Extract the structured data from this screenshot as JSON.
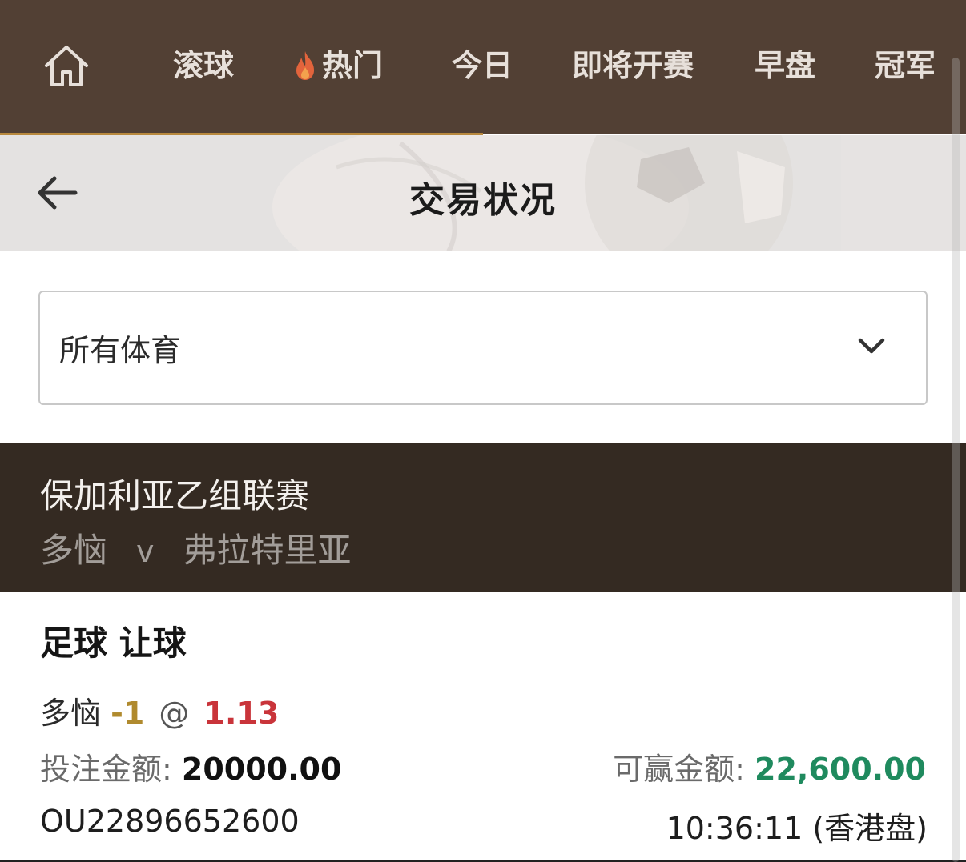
{
  "nav": {
    "home_icon": "home-icon",
    "items": [
      {
        "label": "滚球"
      },
      {
        "label": "热门",
        "icon": "fire-icon"
      },
      {
        "label": "今日"
      },
      {
        "label": "即将开赛"
      },
      {
        "label": "早盘"
      },
      {
        "label": "冠军"
      }
    ],
    "accent": "#b8893e"
  },
  "header": {
    "back_icon": "arrow-left-icon",
    "title": "交易状况"
  },
  "filter": {
    "selected": "所有体育",
    "icon": "chevron-down-icon"
  },
  "league": {
    "name": "保加利亚乙组联赛",
    "home": "多恼",
    "vs": "v",
    "away": "弗拉特里亚"
  },
  "bet": {
    "type": "足球 让球",
    "selection": "多恼",
    "handicap": "-1",
    "at": "@",
    "odds": "1.13",
    "stake_label": "投注金额:",
    "stake_value": "20000.00",
    "win_label": "可赢金额:",
    "win_value": "22,600.00",
    "ticket_id": "OU22896652600",
    "time": "10:36:11",
    "odds_format": "(香港盘)"
  },
  "colors": {
    "nav_bg": "#524034",
    "league_bg": "#342a22",
    "odds": "#c9343a",
    "handicap": "#b08a2e",
    "win": "#1f8a5e"
  }
}
